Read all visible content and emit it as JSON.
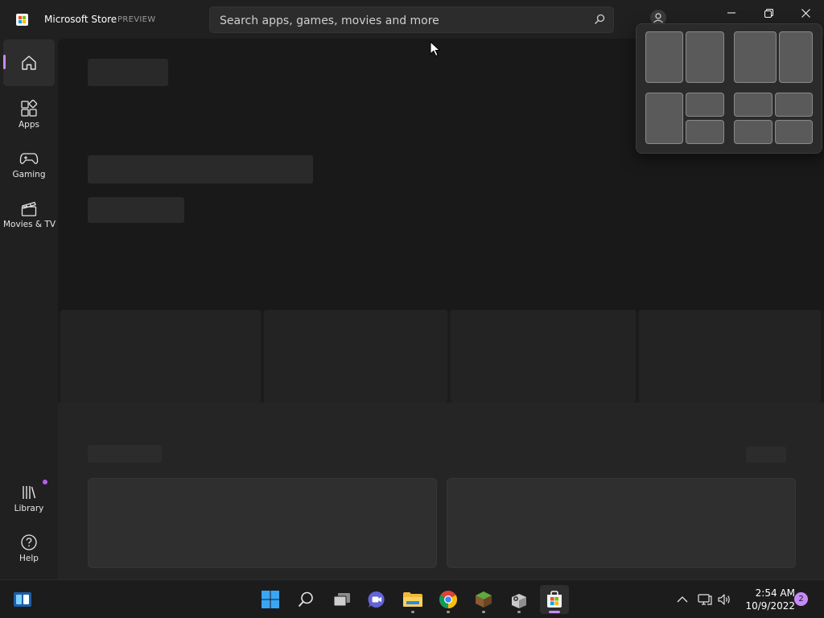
{
  "titlebar": {
    "app_title": "Microsoft Store",
    "preview_label": "PREVIEW",
    "logo_icon": "store-logo",
    "search_placeholder": "Search apps, games, movies and more",
    "search_icon": "search-icon",
    "account_icon": "account-icon",
    "window_controls": [
      "minimize-icon",
      "restore-icon",
      "close-icon"
    ]
  },
  "nav": {
    "accent": "#c58af9",
    "items": [
      {
        "label": "",
        "icon": "home-icon",
        "active": true
      },
      {
        "label": "Apps",
        "icon": "apps-icon"
      },
      {
        "label": "Gaming",
        "icon": "gamepad-icon"
      },
      {
        "label": "Movies & TV",
        "icon": "clapperboard-icon"
      },
      {
        "label": "Library",
        "icon": "library-icon",
        "has_badge": true
      },
      {
        "label": "Help",
        "icon": "help-icon"
      }
    ]
  },
  "content": {
    "state": "loading-skeleton"
  },
  "snap_layouts": {
    "layouts": [
      "two-equal-columns",
      "wide-narrow-columns",
      "one-left-two-right",
      "four-grid"
    ]
  },
  "taskbar": {
    "apps": [
      {
        "icon": "windows-start-icon",
        "running": false
      },
      {
        "icon": "search-icon",
        "running": false
      },
      {
        "icon": "task-view-icon",
        "running": false
      },
      {
        "icon": "chat-icon",
        "running": false
      },
      {
        "icon": "file-explorer-icon",
        "running": true
      },
      {
        "icon": "chrome-icon",
        "running": true
      },
      {
        "icon": "minecraft-icon",
        "running": true
      },
      {
        "icon": "settings-app-icon",
        "running": true
      },
      {
        "icon": "store-icon",
        "running": true,
        "active": true
      }
    ],
    "tray": [
      "chevron-up-icon",
      "network-icon",
      "volume-icon"
    ],
    "widgets_icon": "widgets-icon",
    "time": "2:54 AM",
    "date": "10/9/2022",
    "notification_count": "2"
  }
}
